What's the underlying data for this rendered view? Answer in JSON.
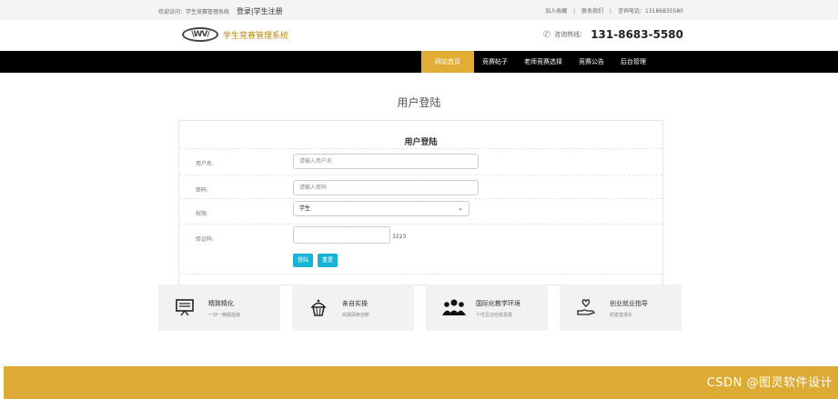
{
  "topbar": {
    "welcome": "欢迎访问：学生竞赛管理系统",
    "login_link": "登录|学生注册",
    "favorites": "加入收藏",
    "contact": "联系我们",
    "phone_label": "咨询电话：13186835580",
    "separator": "|"
  },
  "header": {
    "logo_mark": "\\WV/",
    "site_name": "学生竞赛管理系统",
    "hotline_label": "咨询热线：",
    "hotline_number": "131-8683-5580"
  },
  "nav": {
    "items": [
      {
        "label": "网站首页"
      },
      {
        "label": "竞赛帖子"
      },
      {
        "label": "老师竞赛选择"
      },
      {
        "label": "竞赛公告"
      },
      {
        "label": "后台管理"
      }
    ]
  },
  "page": {
    "heading": "用户登陆"
  },
  "login_form": {
    "title": "用户登陆",
    "username_label": "用户名:",
    "username_placeholder": "请输入用户名",
    "password_label": "密码:",
    "password_placeholder": "请输入密码",
    "role_label": "权限:",
    "role_selected": "学生",
    "captcha_label": "验证码:",
    "captcha_value": "",
    "captcha_code": "3223",
    "login_button": "登陆",
    "reset_button": "重置"
  },
  "features": [
    {
      "icon": "presentation-board-icon",
      "title": "精致精化",
      "subtitle": "一对一精髓指接"
    },
    {
      "icon": "cupcake-icon",
      "title": "亲自实操",
      "subtitle": "实践探索创新"
    },
    {
      "icon": "people-group-icon",
      "title": "国际化教学环境",
      "subtitle": "个性互动自我发展"
    },
    {
      "icon": "hand-heart-icon",
      "title": "创业就业指导",
      "subtitle": "财富直通车"
    }
  ],
  "colors": {
    "accent": "#e2ad35",
    "nav_bg": "#000000",
    "button": "#18b4d4",
    "footer": "#ddaa33"
  },
  "watermark": "CSDN @图灵软件设计"
}
